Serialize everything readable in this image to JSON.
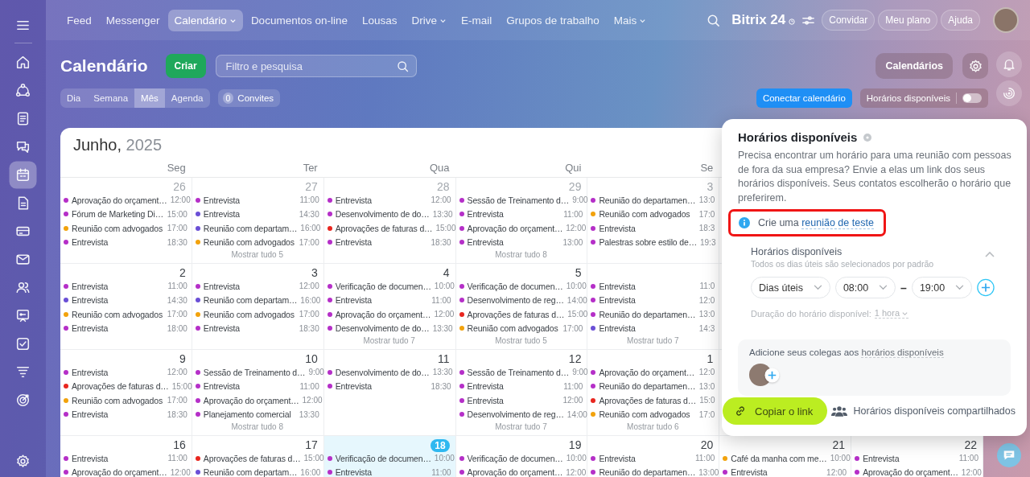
{
  "top_nav": {
    "items": [
      {
        "label": "Feed",
        "selected": false,
        "dropdown": false
      },
      {
        "label": "Messenger",
        "selected": false,
        "dropdown": false
      },
      {
        "label": "Calendário",
        "selected": true,
        "dropdown": true
      },
      {
        "label": "Documentos on-line",
        "selected": false,
        "dropdown": false
      },
      {
        "label": "Lousas",
        "selected": false,
        "dropdown": false
      },
      {
        "label": "Drive",
        "selected": false,
        "dropdown": true
      },
      {
        "label": "E-mail",
        "selected": false,
        "dropdown": false
      },
      {
        "label": "Grupos de trabalho",
        "selected": false,
        "dropdown": false
      },
      {
        "label": "Mais",
        "selected": false,
        "dropdown": true
      }
    ],
    "logo": "Bitrix 24",
    "buttons": [
      "Convidar",
      "Meu plano",
      "Ajuda"
    ]
  },
  "sidebar": {
    "items": [
      {
        "kind": "home",
        "selected": false
      },
      {
        "kind": "nodes",
        "selected": false
      },
      {
        "kind": "feed",
        "selected": false
      },
      {
        "kind": "chat",
        "selected": false
      },
      {
        "kind": "calendar",
        "selected": true
      },
      {
        "kind": "document",
        "selected": false
      },
      {
        "kind": "card",
        "selected": false
      },
      {
        "kind": "mail",
        "selected": false
      },
      {
        "kind": "contacts",
        "selected": false
      },
      {
        "kind": "board",
        "selected": false
      },
      {
        "kind": "task",
        "selected": false
      },
      {
        "kind": "funnel",
        "selected": false
      },
      {
        "kind": "target",
        "selected": false
      }
    ],
    "bottom": [
      {
        "kind": "settings",
        "selected": false
      }
    ]
  },
  "header": {
    "title": "Calendário",
    "create_button": "Criar",
    "search_placeholder": "Filtro e pesquisa",
    "calendars_button": "Calendários"
  },
  "toolbar": {
    "views": [
      {
        "label": "Dia",
        "selected": false
      },
      {
        "label": "Semana",
        "selected": false
      },
      {
        "label": "Mês",
        "selected": true
      },
      {
        "label": "Agenda",
        "selected": false
      }
    ],
    "invites": {
      "count": "0",
      "label": "Convites"
    },
    "connect_button": "Conectar calendário",
    "availability": {
      "label": "Horários disponíveis",
      "on": false
    }
  },
  "calendar": {
    "month": "Junho,",
    "year": "2025",
    "weekdays": [
      "Seg",
      "Ter",
      "Qua",
      "Qui",
      "Se"
    ],
    "weeks": [
      {
        "days": [
          {
            "number": "26",
            "muted": true,
            "today": false,
            "events": [
              {
                "title": "Aprovação do orçament…",
                "time": "12:00",
                "color": "#b52fc8"
              },
              {
                "title": "Fórum de Marketing Di…",
                "time": "15:00",
                "color": "#b52fc8"
              },
              {
                "title": "Reunião com advogados",
                "time": "17:00",
                "color": "#f2a20c"
              },
              {
                "title": "Entrevista",
                "time": "18:30",
                "color": "#b52fc8"
              }
            ]
          },
          {
            "number": "27",
            "muted": true,
            "today": false,
            "events": [
              {
                "title": "Entrevista",
                "time": "11:00",
                "color": "#b52fc8"
              },
              {
                "title": "Entrevista",
                "time": "14:30",
                "color": "#6a4fd6"
              },
              {
                "title": "Reunião com departam…",
                "time": "16:00",
                "color": "#6a4fd6"
              },
              {
                "title": "Reunião com advogados",
                "time": "17:00",
                "color": "#f2a20c"
              }
            ],
            "more": "Mostrar tudo 5"
          },
          {
            "number": "28",
            "muted": true,
            "today": false,
            "events": [
              {
                "title": "Entrevista",
                "time": "12:00",
                "color": "#b52fc8"
              },
              {
                "title": "Desenvolvimento de do…",
                "time": "13:30",
                "color": "#b52fc8"
              },
              {
                "title": "Aprovações de faturas d…",
                "time": "15:00",
                "color": "#e8261f"
              },
              {
                "title": "Entrevista",
                "time": "18:30",
                "color": "#b52fc8"
              }
            ]
          },
          {
            "number": "29",
            "muted": true,
            "today": false,
            "events": [
              {
                "title": "Sessão de Treinamento d…",
                "time": "9:00",
                "color": "#b52fc8"
              },
              {
                "title": "Entrevista",
                "time": "11:00",
                "color": "#b52fc8"
              },
              {
                "title": "Aprovação do orçament…",
                "time": "12:00",
                "color": "#b52fc8"
              },
              {
                "title": "Entrevista",
                "time": "13:00",
                "color": "#b52fc8"
              }
            ],
            "more": "Mostrar tudo 8"
          },
          {
            "number": "3",
            "muted": true,
            "today": false,
            "events": [
              {
                "title": "Reunião do departamen…",
                "time": "13:0",
                "color": "#b52fc8"
              },
              {
                "title": "Reunião com advogados",
                "time": "17:0",
                "color": "#f2a20c"
              },
              {
                "title": "Entrevista",
                "time": "18:3",
                "color": "#b52fc8"
              },
              {
                "title": "Palestras sobre estilo de…",
                "time": "19:3",
                "color": "#b52fc8"
              }
            ]
          }
        ]
      },
      {
        "days": [
          {
            "number": "2",
            "muted": false,
            "today": false,
            "events": [
              {
                "title": "Entrevista",
                "time": "11:00",
                "color": "#b52fc8"
              },
              {
                "title": "Entrevista",
                "time": "14:30",
                "color": "#6a4fd6"
              },
              {
                "title": "Reunião com advogados",
                "time": "17:00",
                "color": "#f2a20c"
              },
              {
                "title": "Entrevista",
                "time": "18:00",
                "color": "#b52fc8"
              }
            ]
          },
          {
            "number": "3",
            "muted": false,
            "today": false,
            "events": [
              {
                "title": "Entrevista",
                "time": "12:00",
                "color": "#b52fc8"
              },
              {
                "title": "Reunião com departam…",
                "time": "16:00",
                "color": "#6a4fd6"
              },
              {
                "title": "Reunião com advogados",
                "time": "17:00",
                "color": "#f2a20c"
              },
              {
                "title": "Entrevista",
                "time": "18:30",
                "color": "#b52fc8"
              }
            ]
          },
          {
            "number": "4",
            "muted": false,
            "today": false,
            "events": [
              {
                "title": "Verificação de documen…",
                "time": "10:00",
                "color": "#b52fc8"
              },
              {
                "title": "Entrevista",
                "time": "11:00",
                "color": "#b52fc8"
              },
              {
                "title": "Aprovação do orçament…",
                "time": "12:00",
                "color": "#b52fc8"
              },
              {
                "title": "Desenvolvimento de do…",
                "time": "13:30",
                "color": "#b52fc8"
              }
            ],
            "more": "Mostrar tudo 7"
          },
          {
            "number": "5",
            "muted": false,
            "today": false,
            "events": [
              {
                "title": "Verificação de documen…",
                "time": "10:00",
                "color": "#b52fc8"
              },
              {
                "title": "Desenvolvimento de reg…",
                "time": "14:00",
                "color": "#b52fc8"
              },
              {
                "title": "Aprovações de faturas d…",
                "time": "15:00",
                "color": "#e8261f"
              },
              {
                "title": "Reunião com advogados",
                "time": "17:00",
                "color": "#f2a20c"
              }
            ],
            "more": "Mostrar tudo 5"
          },
          {
            "today": false,
            "events": [
              {
                "title": "Entrevista",
                "time": "11:0",
                "color": "#b52fc8"
              },
              {
                "title": "Entrevista",
                "time": "12:0",
                "color": "#b52fc8"
              },
              {
                "title": "Reunião do departamen…",
                "time": "13:0",
                "color": "#b52fc8"
              },
              {
                "title": "Entrevista",
                "time": "14:3",
                "color": "#6a4fd6"
              }
            ],
            "more": "Mostrar tudo 7"
          }
        ]
      },
      {
        "days": [
          {
            "number": "9",
            "muted": false,
            "today": false,
            "events": [
              {
                "title": "Entrevista",
                "time": "12:00",
                "color": "#b52fc8"
              },
              {
                "title": "Aprovações de faturas d…",
                "time": "15:00",
                "color": "#e8261f"
              },
              {
                "title": "Reunião com advogados",
                "time": "17:00",
                "color": "#f2a20c"
              },
              {
                "title": "Entrevista",
                "time": "18:30",
                "color": "#b52fc8"
              }
            ]
          },
          {
            "number": "10",
            "muted": false,
            "today": false,
            "events": [
              {
                "title": "Sessão de Treinamento d…",
                "time": "9:00",
                "color": "#b52fc8"
              },
              {
                "title": "Entrevista",
                "time": "11:00",
                "color": "#b52fc8"
              },
              {
                "title": "Aprovação do orçament…",
                "time": "12:00",
                "color": "#b52fc8"
              },
              {
                "title": "Planejamento comercial",
                "time": "13:30",
                "color": "#b52fc8"
              }
            ],
            "more": "Mostrar tudo 8"
          },
          {
            "number": "11",
            "muted": false,
            "today": false,
            "events": [
              {
                "title": "Desenvolvimento de do…",
                "time": "13:30",
                "color": "#b52fc8"
              },
              {
                "title": "Entrevista",
                "time": "18:30",
                "color": "#b52fc8"
              }
            ]
          },
          {
            "number": "12",
            "muted": false,
            "today": false,
            "events": [
              {
                "title": "Sessão de Treinamento d…",
                "time": "9:00",
                "color": "#b52fc8"
              },
              {
                "title": "Entrevista",
                "time": "11:00",
                "color": "#b52fc8"
              },
              {
                "title": "Entrevista",
                "time": "12:00",
                "color": "#b52fc8"
              },
              {
                "title": "Desenvolvimento de reg…",
                "time": "14:00",
                "color": "#b52fc8"
              }
            ],
            "more": "Mostrar tudo 7"
          },
          {
            "number": "1",
            "muted": false,
            "today": false,
            "events": [
              {
                "title": "Aprovação do orçament…",
                "time": "12:0",
                "color": "#b52fc8"
              },
              {
                "title": "Reunião do departamen…",
                "time": "13:0",
                "color": "#b52fc8"
              },
              {
                "title": "Aprovações de faturas d…",
                "time": "15:0",
                "color": "#e8261f"
              },
              {
                "title": "Reunião com advogados",
                "time": "17:0",
                "color": "#f2a20c"
              }
            ],
            "more": "Mostrar tudo 6"
          }
        ]
      },
      {
        "days": [
          {
            "number": "16",
            "muted": false,
            "today": false,
            "events": [
              {
                "title": "Entrevista",
                "time": "11:00",
                "color": "#b52fc8"
              },
              {
                "title": "Aprovação do orçament…",
                "time": "12:00",
                "color": "#b52fc8"
              }
            ]
          },
          {
            "number": "17",
            "muted": false,
            "today": false,
            "events": [
              {
                "title": "Aprovações de faturas d…",
                "time": "15:00",
                "color": "#e8261f"
              },
              {
                "title": "Reunião com departam…",
                "time": "16:00",
                "color": "#6a4fd6"
              }
            ]
          },
          {
            "number": "18",
            "muted": false,
            "today": true,
            "events": [
              {
                "title": "Verificação de documen…",
                "time": "10:00",
                "color": "#b52fc8"
              },
              {
                "title": "Entrevista",
                "time": "11:00",
                "color": "#b52fc8"
              }
            ]
          },
          {
            "number": "19",
            "muted": false,
            "today": false,
            "events": [
              {
                "title": "Verificação de documen…",
                "time": "10:00",
                "color": "#b52fc8"
              },
              {
                "title": "Aprovação do orçament…",
                "time": "12:00",
                "color": "#b52fc8"
              }
            ]
          },
          {
            "number": "20",
            "muted": false,
            "today": false,
            "events": [
              {
                "title": "Entrevista",
                "time": "11:00",
                "color": "#b52fc8"
              },
              {
                "title": "Reunião do departamen…",
                "time": "13:00",
                "color": "#b52fc8"
              }
            ]
          },
          {
            "number": "21",
            "muted": false,
            "today": false,
            "events": [
              {
                "title": "Café da manha com me…",
                "time": "10:00",
                "color": "#f2a20c"
              },
              {
                "title": "Entrevista",
                "time": "12:00",
                "color": "#b52fc8"
              }
            ]
          },
          {
            "number": "22",
            "muted": false,
            "today": false,
            "events": [
              {
                "title": "Entrevista",
                "time": "11:00",
                "color": "#b52fc8"
              },
              {
                "title": "Aprovação do orçament…",
                "time": "12:00",
                "color": "#b52fc8"
              }
            ]
          }
        ]
      }
    ]
  },
  "popup": {
    "title": "Horários disponíveis",
    "description": "Precisa encontrar um horário para uma reunião com pessoas de fora da sua empresa? Envie a elas um link dos seus horários disponíveis. Seus contatos escolherão o horário que preferirem.",
    "hint": {
      "prefix": "Crie uma",
      "link": "reunião de teste"
    },
    "section": {
      "title": "Horários disponíveis",
      "subtitle": "Todos os dias úteis são selecionados por padrão",
      "expanded": true,
      "days": "Dias úteis",
      "from": "08:00",
      "separator": "–",
      "to": "19:00",
      "duration_label": "Duração do horário disponível:",
      "duration": "1 hora"
    },
    "colleagues": {
      "prefix": "Adicione seus colegas aos",
      "link": "horários disponíveis"
    },
    "copy_button": "Copiar o link",
    "shared_link": "Horários disponíveis compartilhados"
  }
}
